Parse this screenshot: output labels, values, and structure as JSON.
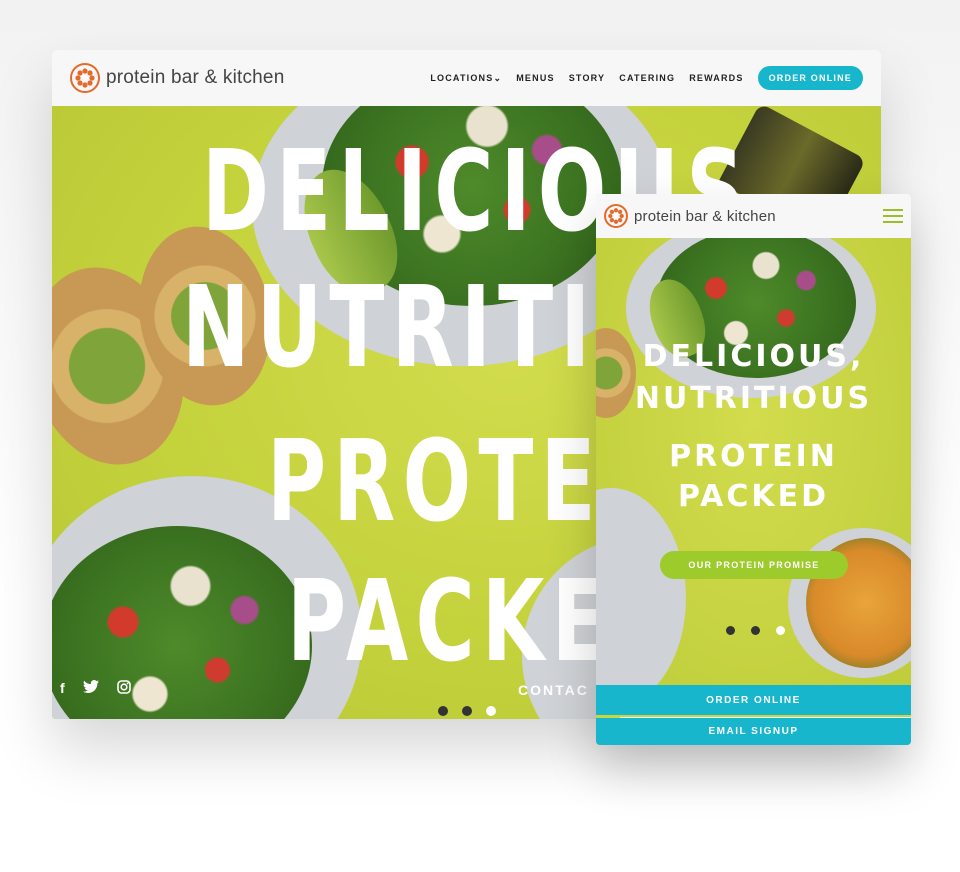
{
  "brand": {
    "name": "protein bar & kitchen",
    "accent": "#e36a2b",
    "cta_color": "#17b6cc",
    "lime": "#9ccb2b"
  },
  "desktop": {
    "nav": {
      "items": [
        "LOCATIONS",
        "MENUS",
        "STORY",
        "CATERING",
        "REWARDS"
      ],
      "locations_caret": "⌄",
      "order_button": "ORDER ONLINE"
    },
    "hero": {
      "line1": "DELICIOUS",
      "line2": "NUTRITIO",
      "line3": "PROTE",
      "line4": "PACKE"
    },
    "social": {
      "facebook": "f",
      "twitter": "🐦",
      "instagram": "◎"
    },
    "contact": "CONTAC",
    "slider_dots": 3
  },
  "mobile": {
    "hero": {
      "line1": "DELICIOUS,",
      "line2": "NUTRITIOUS",
      "line3": "PROTEIN",
      "line4": "PACKED"
    },
    "promise_button": "OUR PROTEIN PROMISE",
    "order_bar": "ORDER ONLINE",
    "email_bar": "EMAIL SIGNUP"
  }
}
